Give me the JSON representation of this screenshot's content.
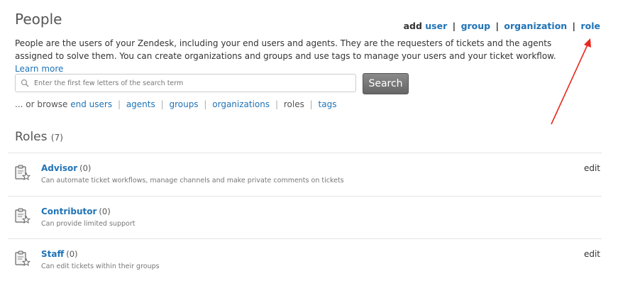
{
  "page": {
    "title": "People",
    "intro_text": "People are the users of your Zendesk, including your end users and agents. They are the requesters of tickets and the agents assigned to solve them. You can create organizations and groups and use tags to manage your users and your ticket workflow.",
    "learn_more": "Learn more"
  },
  "actions": {
    "add_label": "add",
    "user": "user",
    "group": "group",
    "organization": "organization",
    "role": "role",
    "separator": "|"
  },
  "search": {
    "placeholder": "Enter the first few letters of the search term",
    "value": "",
    "button_label": "Search",
    "icon": "search-icon"
  },
  "browse": {
    "prefix": "... or browse",
    "end_users": "end users",
    "agents": "agents",
    "groups": "groups",
    "organizations": "organizations",
    "roles": "roles",
    "tags": "tags",
    "separator": "|"
  },
  "roles": {
    "heading": "Roles",
    "count": "(7)",
    "items": [
      {
        "name": "Advisor",
        "count": "(0)",
        "description": "Can automate ticket workflows, manage channels and make private comments on tickets",
        "edit": "edit",
        "icon": "clipboard-star-icon"
      },
      {
        "name": "Contributor",
        "count": "(0)",
        "description": "Can provide limited support",
        "edit": "",
        "icon": "clipboard-star-icon"
      },
      {
        "name": "Staff",
        "count": "(0)",
        "description": "Can edit tickets within their groups",
        "edit": "edit",
        "icon": "clipboard-star-icon"
      }
    ]
  },
  "colors": {
    "link": "#1f73b7",
    "annotation_arrow": "#e8281e",
    "search_button": "#777777"
  }
}
